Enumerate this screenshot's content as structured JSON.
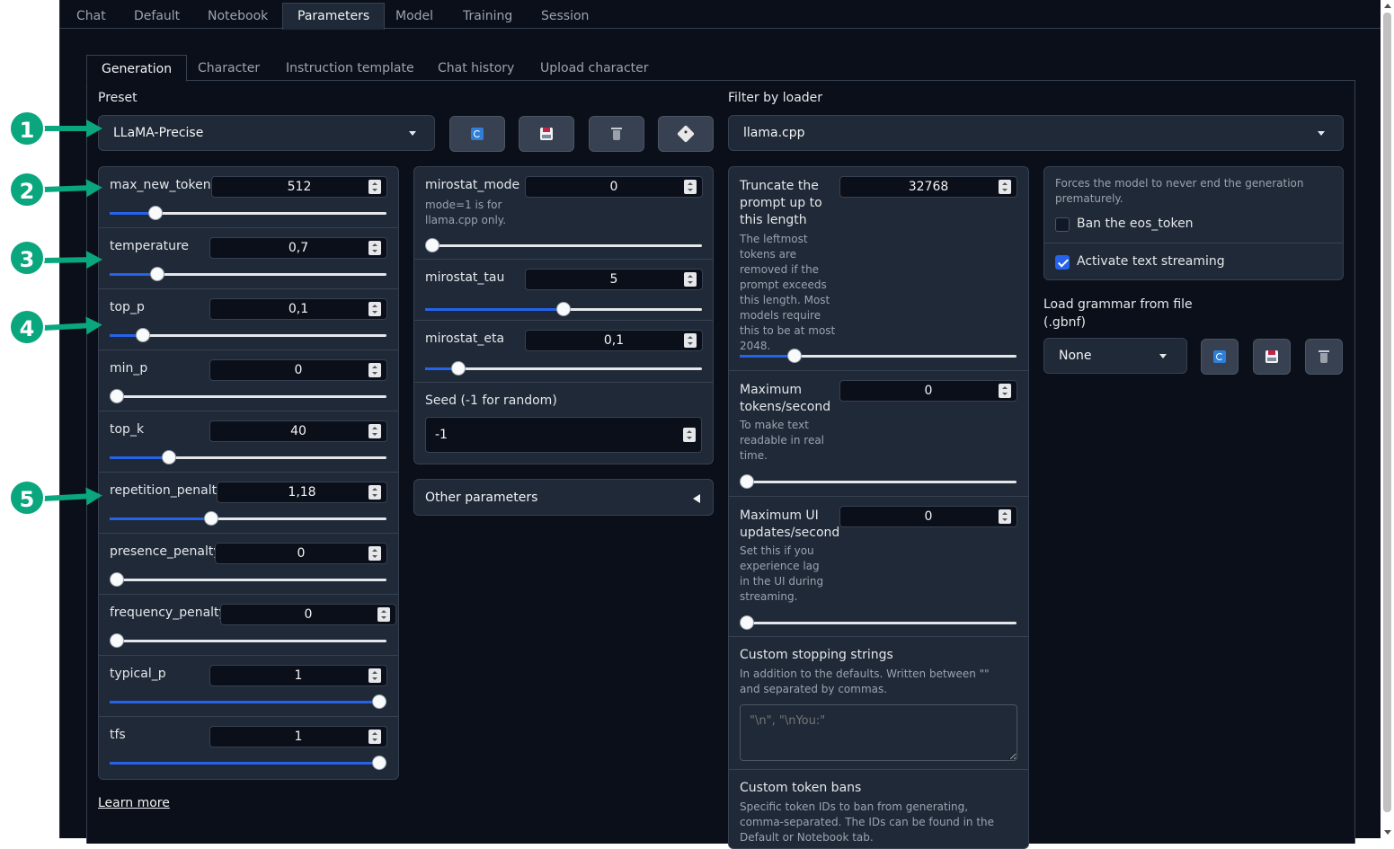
{
  "top_tabs": [
    "Chat",
    "Default",
    "Notebook",
    "Parameters",
    "Model",
    "Training",
    "Session"
  ],
  "active_top_tab": "Parameters",
  "sub_tabs": [
    "Generation",
    "Character",
    "Instruction template",
    "Chat history",
    "Upload character"
  ],
  "active_sub_tab": "Generation",
  "preset": {
    "label": "Preset",
    "value": "LLaMA-Precise",
    "buttons": [
      "refresh-icon",
      "save-icon",
      "trash-icon",
      "dice-icon"
    ]
  },
  "filter": {
    "label": "Filter by loader",
    "value": "llama.cpp"
  },
  "sampling": [
    {
      "name": "max_new_tokens",
      "value": "512",
      "fraction": 0.148
    },
    {
      "name": "temperature",
      "value": "0,7",
      "fraction": 0.155
    },
    {
      "name": "top_p",
      "value": "0,1",
      "fraction": 0.1
    },
    {
      "name": "min_p",
      "value": "0",
      "fraction": 0.0
    },
    {
      "name": "top_k",
      "value": "40",
      "fraction": 0.2
    },
    {
      "name": "repetition_penalty",
      "value": "1,18",
      "fraction": 0.36
    },
    {
      "name": "presence_penalty",
      "value": "0",
      "fraction": 0.0
    },
    {
      "name": "frequency_penalty",
      "value": "0",
      "fraction": 0.0
    },
    {
      "name": "typical_p",
      "value": "1",
      "fraction": 1.0
    },
    {
      "name": "tfs",
      "value": "1",
      "fraction": 1.0
    }
  ],
  "mirostat": [
    {
      "name": "mirostat_mode",
      "value": "0",
      "desc": "mode=1 is for llama.cpp only.",
      "fraction": 0.0
    },
    {
      "name": "mirostat_tau",
      "value": "5",
      "desc": "",
      "fraction": 0.5
    },
    {
      "name": "mirostat_eta",
      "value": "0,1",
      "desc": "",
      "fraction": 0.1
    }
  ],
  "seed": {
    "label": "Seed (-1 for random)",
    "value": "-1"
  },
  "other_parameters": "Other parameters",
  "learn_more": "Learn more",
  "truncate": {
    "name": "Truncate the prompt up to this length",
    "value": "32768",
    "desc": "The leftmost tokens are removed if the prompt exceeds this length. Most models require this to be at most 2048.",
    "fraction": 0.18
  },
  "max_tps": {
    "name": "Maximum tokens/second",
    "value": "0",
    "desc": "To make text readable in real time.",
    "fraction": 0.0
  },
  "max_ui": {
    "name": "Maximum UI updates/second",
    "value": "0",
    "desc": "Set this if you experience lag in the UI during streaming.",
    "fraction": 0.0
  },
  "stopping": {
    "title": "Custom stopping strings",
    "desc": "In addition to the defaults. Written between \"\" and separated by commas.",
    "placeholder": "\"\\n\", \"\\nYou:\""
  },
  "token_bans": {
    "title": "Custom token bans",
    "desc": "Specific token IDs to ban from generating, comma-separated. The IDs can be found in the Default or Notebook tab."
  },
  "options": {
    "ban_desc": "Forces the model to never end the generation prematurely.",
    "ban_label": "Ban the eos_token",
    "ban_checked": false,
    "stream_label": "Activate text streaming",
    "stream_checked": true
  },
  "grammar": {
    "label": "Load grammar from file (.gbnf)",
    "value": "None",
    "buttons": [
      "refresh-icon",
      "save-icon",
      "trash-icon"
    ]
  },
  "callouts": [
    "1",
    "2",
    "3",
    "4",
    "5"
  ],
  "colors": {
    "accent": "#2563eb",
    "callout": "#0aa67e",
    "background": "#0b0f19",
    "panel": "#1f2937"
  }
}
